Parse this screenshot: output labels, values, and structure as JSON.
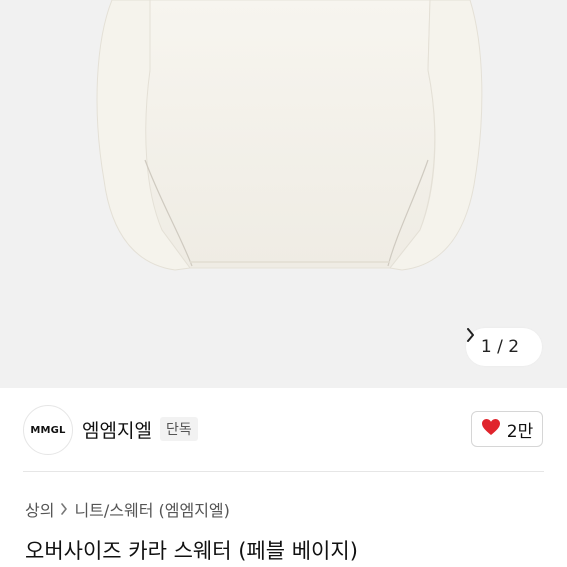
{
  "gallery": {
    "counter": "1 / 2"
  },
  "brand": {
    "logo_text": "MMGL",
    "name": "엠엠지엘",
    "tag": "단독"
  },
  "like": {
    "count": "2만",
    "heart_color": "#e0242c"
  },
  "breadcrumb": {
    "category": "상의",
    "subcategory": "니트/스웨터 (엠엠지엘)"
  },
  "product": {
    "title": "오버사이즈 카라 스웨터 (페블 베이지)"
  }
}
